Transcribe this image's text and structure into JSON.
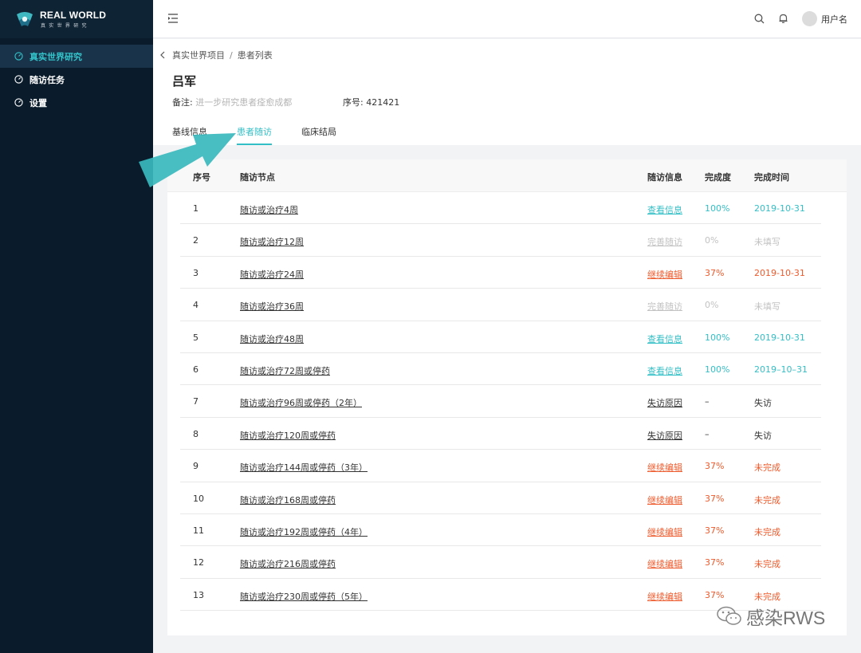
{
  "app": {
    "logo_title": "REAL WORLD",
    "logo_sub": "真实世界研究"
  },
  "sidebar": {
    "items": [
      {
        "label": "真实世界研究",
        "active": true
      },
      {
        "label": "随访任务",
        "active": false
      },
      {
        "label": "设置",
        "active": false
      }
    ]
  },
  "header": {
    "username": "用户名"
  },
  "breadcrumb": {
    "parent": "真实世界项目",
    "separator": "/",
    "current": "患者列表"
  },
  "patient": {
    "name": "吕军",
    "remark_label": "备注:",
    "remark_value": "进一步研究患者痊愈成都",
    "serial_label": "序号:",
    "serial_value": "421421"
  },
  "tabs": [
    {
      "label": "基线信息",
      "active": false
    },
    {
      "label": "患者随访",
      "active": true
    },
    {
      "label": "临床结局",
      "active": false
    }
  ],
  "table": {
    "headers": {
      "no": "序号",
      "node": "随访节点",
      "info": "随访信息",
      "pct": "完成度",
      "time": "完成时间"
    },
    "rows": [
      {
        "no": "1",
        "node": "随访或治疗4周",
        "info": "查看信息",
        "pct": "100%",
        "time": "2019-10-31",
        "status": "done"
      },
      {
        "no": "2",
        "node": "随访或治疗12周",
        "info": "完善随访",
        "pct": "0%",
        "time": "未填写",
        "status": "empty"
      },
      {
        "no": "3",
        "node": "随访或治疗24周",
        "info": "继续编辑",
        "pct": "37%",
        "time": "2019-10-31",
        "status": "edit"
      },
      {
        "no": "4",
        "node": "随访或治疗36周",
        "info": "完善随访",
        "pct": "0%",
        "time": "未填写",
        "status": "empty"
      },
      {
        "no": "5",
        "node": "随访或治疗48周",
        "info": "查看信息",
        "pct": "100%",
        "time": "2019-10-31",
        "status": "done"
      },
      {
        "no": "6",
        "node": "随访或治疗72周或停药",
        "info": "查看信息",
        "pct": "100%",
        "time": "2019–10–31",
        "status": "done"
      },
      {
        "no": "7",
        "node": "随访或治疗96周或停药（2年）",
        "info": "失访原因",
        "pct": "–",
        "time": "失访",
        "status": "lost"
      },
      {
        "no": "8",
        "node": "随访或治疗120周或停药",
        "info": "失访原因",
        "pct": "–",
        "time": "失访",
        "status": "lost"
      },
      {
        "no": "9",
        "node": "随访或治疗144周或停药（3年）",
        "info": "继续编辑",
        "pct": "37%",
        "time": "未完成",
        "status": "edit"
      },
      {
        "no": "10",
        "node": "随访或治疗168周或停药",
        "info": "继续编辑",
        "pct": "37%",
        "time": "未完成",
        "status": "edit"
      },
      {
        "no": "11",
        "node": "随访或治疗192周或停药（4年）",
        "info": "继续编辑",
        "pct": "37%",
        "time": "未完成",
        "status": "edit"
      },
      {
        "no": "12",
        "node": "随访或治疗216周或停药",
        "info": "继续编辑",
        "pct": "37%",
        "time": "未完成",
        "status": "edit"
      },
      {
        "no": "13",
        "node": "随访或治疗230周或停药（5年）",
        "info": "继续编辑",
        "pct": "37%",
        "time": "未完成",
        "status": "edit"
      }
    ]
  },
  "watermark": {
    "text": "感染RWS"
  },
  "colors": {
    "sidebar_bg": "#0a1c2c",
    "accent_teal": "#33bfc6",
    "edit_orange": "#ef5a2c",
    "muted_gray": "#c2c2c2"
  },
  "icons": {
    "logo": "real-world-logo",
    "nav": "gauge-icon",
    "menu": "menu-fold-icon",
    "search": "search-icon",
    "bell": "bell-icon",
    "back": "chevron-left-icon",
    "annotation": "arrow-annotation",
    "watermark": "wechat-icon"
  }
}
